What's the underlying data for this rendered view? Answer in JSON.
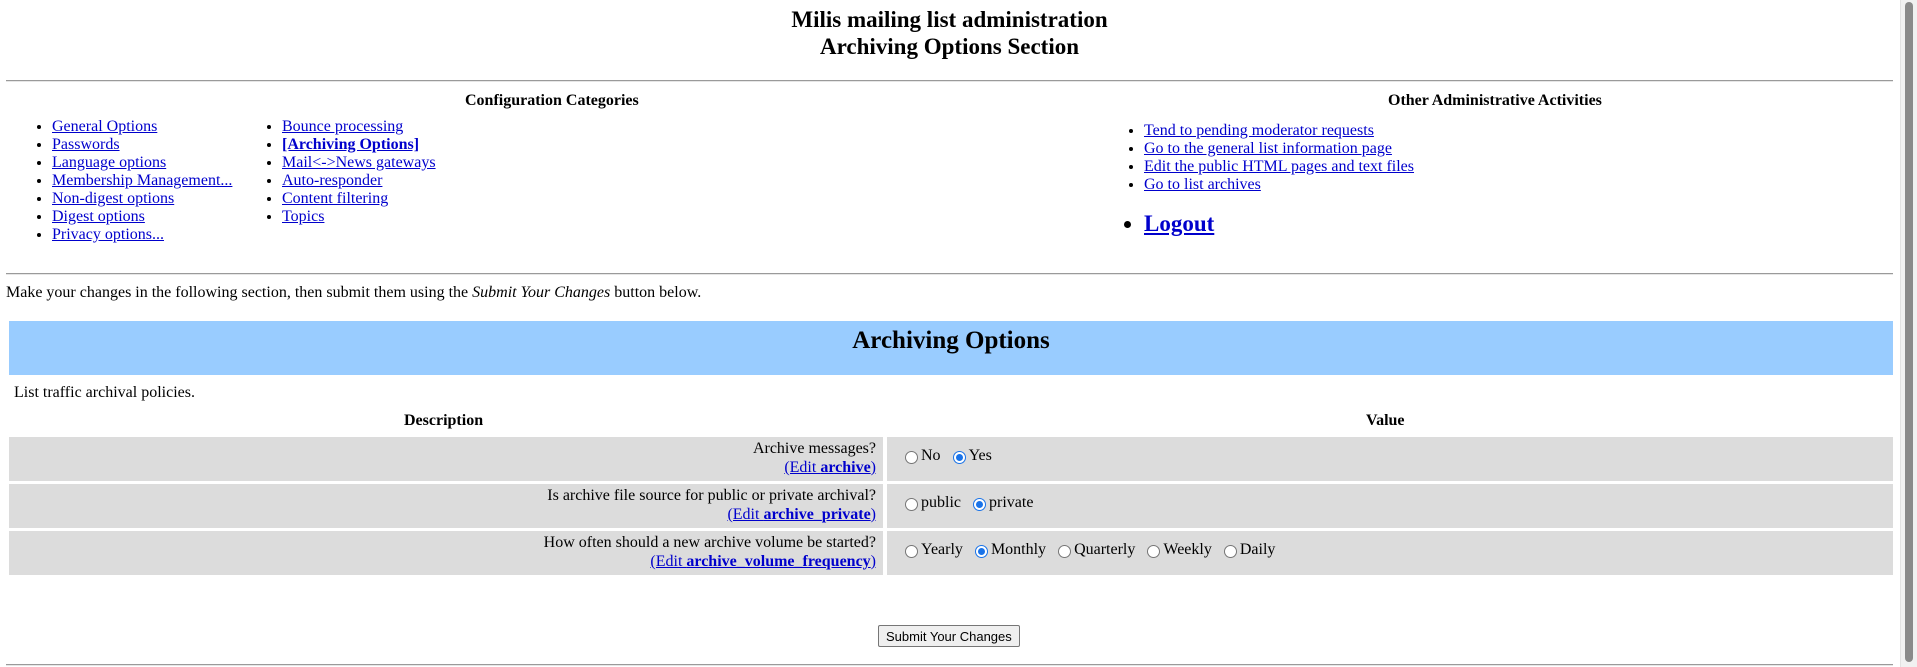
{
  "header": {
    "title_line1": "Milis mailing list administration",
    "title_line2": "Archiving Options Section"
  },
  "config": {
    "heading": "Configuration Categories",
    "col1": [
      "General Options",
      "Passwords",
      "Language options",
      "Membership Management...",
      "Non-digest options",
      "Digest options",
      "Privacy options..."
    ],
    "col2": [
      "Bounce processing",
      "[Archiving Options]",
      "Mail<->News gateways",
      "Auto-responder",
      "Content filtering",
      "Topics"
    ]
  },
  "other": {
    "heading": "Other Administrative Activities",
    "items": [
      "Tend to pending moderator requests",
      "Go to the general list information page",
      "Edit the public HTML pages and text files",
      "Go to list archives"
    ],
    "logout": "Logout"
  },
  "intro": {
    "before": "Make your changes in the following section, then submit them using the ",
    "em": "Submit Your Changes",
    "after": " button below."
  },
  "section": {
    "banner": "Archiving Options",
    "policy": "List traffic archival policies.",
    "col_description": "Description",
    "col_value": "Value"
  },
  "rows": [
    {
      "question": "Archive messages?",
      "edit_prefix": "(Edit ",
      "edit_var": "archive",
      "edit_suffix": ")",
      "options": [
        "No",
        "Yes"
      ],
      "selected": "Yes"
    },
    {
      "question": "Is archive file source for public or private archival?",
      "edit_prefix": "(Edit ",
      "edit_var": "archive_private",
      "edit_suffix": ")",
      "options": [
        "public",
        "private"
      ],
      "selected": "private"
    },
    {
      "question": "How often should a new archive volume be started?",
      "edit_prefix": "(Edit ",
      "edit_var": "archive_volume_frequency",
      "edit_suffix": ")",
      "options": [
        "Yearly",
        "Monthly",
        "Quarterly",
        "Weekly",
        "Daily"
      ],
      "selected": "Monthly"
    }
  ],
  "submit": {
    "label": "Submit Your Changes"
  }
}
